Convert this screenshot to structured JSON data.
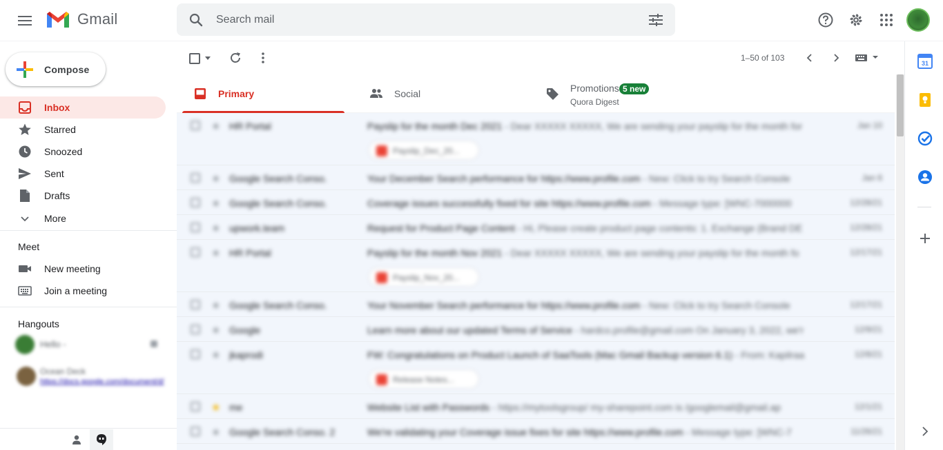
{
  "header": {
    "logo_text": "Gmail",
    "search_placeholder": "Search mail"
  },
  "sidebar": {
    "compose_label": "Compose",
    "items": [
      {
        "label": "Inbox",
        "icon": "inbox-icon"
      },
      {
        "label": "Starred",
        "icon": "star-icon"
      },
      {
        "label": "Snoozed",
        "icon": "clock-icon"
      },
      {
        "label": "Sent",
        "icon": "send-icon"
      },
      {
        "label": "Drafts",
        "icon": "draft-icon"
      },
      {
        "label": "More",
        "icon": "chevron-down-icon"
      }
    ],
    "meet": {
      "title": "Meet",
      "new_meeting": "New meeting",
      "join_meeting": "Join a meeting"
    },
    "hangouts": {
      "title": "Hangouts",
      "contacts": [
        {
          "name": "Hello -"
        },
        {
          "name": "Ocean Deck",
          "preview": "https://docs.google.com/document/d/"
        }
      ]
    }
  },
  "toolbar": {
    "pagination": "1–50 of 103"
  },
  "tabs": [
    {
      "label": "Primary",
      "active": true
    },
    {
      "label": "Social",
      "active": false
    },
    {
      "label": "Promotions",
      "active": false,
      "badge": "5 new",
      "subtitle": "Quora Digest"
    }
  ],
  "emails": [
    {
      "sender": "HR Portal",
      "subject": "Payslip for the month Dec 2021",
      "snippet": "- Dear XXXXX XXXXX, We are sending your payslip for the month for",
      "date": "Jan 10",
      "attachment": "Payslip_Dec_20...",
      "starred": false
    },
    {
      "sender": "Google Search Conso.",
      "subject": "Your December Search performance for https://www.profile.com",
      "snippet": "- New: Click to try Search Console",
      "date": "Jan 6",
      "starred": false
    },
    {
      "sender": "Google Search Conso.",
      "subject": "Coverage issues successfully fixed for site https://www.profile.com",
      "snippet": "- Message type: [WNC-7000000",
      "date": "12/28/21",
      "starred": false
    },
    {
      "sender": "upwork.team",
      "subject": "Request for Product Page Content",
      "snippet": "- Hi, Please create product page contents: 1. Exchange (Brand DE",
      "date": "12/28/21",
      "starred": false
    },
    {
      "sender": "HR Portal",
      "subject": "Payslip for the month Nov 2021",
      "snippet": "- Dear XXXXX XXXXX, We are sending your payslip for the month fo",
      "date": "12/17/21",
      "attachment": "Payslip_Nov_20...",
      "starred": false
    },
    {
      "sender": "Google Search Conso.",
      "subject": "Your November Search performance for https://www.profile.com",
      "snippet": "- New: Click to try Search Console",
      "date": "12/17/21",
      "starred": false
    },
    {
      "sender": "Google",
      "subject": "Learn more about our updated Terms of Service",
      "snippet": "- hardco.profile@gmail.com On January 3, 2022, we'r",
      "date": "12/9/21",
      "starred": false
    },
    {
      "sender": "jkaprodi",
      "subject": "FW: Congratulations on Product Launch of SaaTools (Mac Gmail Backup version 6.1)",
      "snippet": "- From: Kapilraa",
      "date": "12/8/21",
      "attachment": "Release Notes...",
      "starred": false
    },
    {
      "sender": "me",
      "subject": "Website List with Passwords",
      "snippet": "- https://mytoolsgroup/ my-sharepoint.com is /googlemail@gmail.ap",
      "date": "12/1/21",
      "starred": true
    },
    {
      "sender": "Google Search Conso. 2",
      "subject": "We're validating your Coverage issue fixes for site https://www.profile.com",
      "snippet": "- Message type: [WNC-7",
      "date": "11/26/21",
      "starred": false
    }
  ],
  "colors": {
    "accent_red": "#d93025",
    "inbox_bg": "#fce8e6",
    "badge_green": "#188038"
  }
}
